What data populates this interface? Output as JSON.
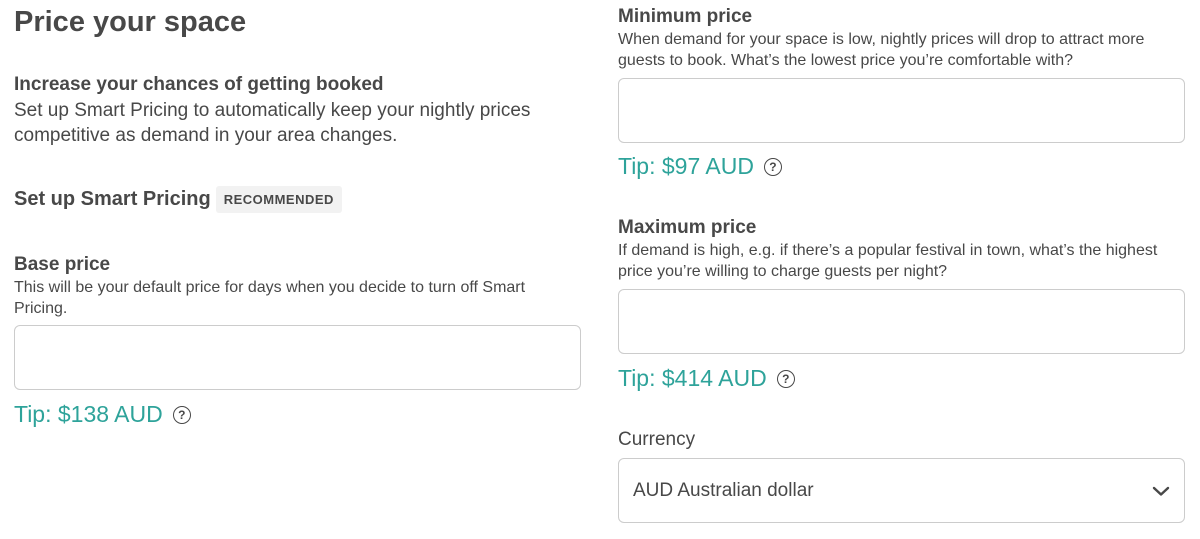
{
  "page": {
    "title": "Price your space"
  },
  "intro": {
    "heading": "Increase your chances of getting booked",
    "description": "Set up Smart Pricing to automatically keep your nightly prices competitive as demand in your area changes."
  },
  "smart_pricing": {
    "heading": "Set up Smart Pricing",
    "badge": "RECOMMENDED"
  },
  "base_price": {
    "label": "Base price",
    "description": "This will be your default price for days when you decide to turn off Smart Pricing.",
    "value": "",
    "placeholder": "",
    "tip": "Tip: $138 AUD"
  },
  "minimum_price": {
    "label": "Minimum price",
    "description": "When demand for your space is low, nightly prices will drop to attract more guests to book. What’s the lowest price you’re comfortable with?",
    "value": "",
    "placeholder": "",
    "tip": "Tip: $97 AUD"
  },
  "maximum_price": {
    "label": "Maximum price",
    "description": "If demand is high, e.g. if there’s a popular festival in town, what’s the highest price you’re willing to charge guests per night?",
    "value": "",
    "placeholder": "",
    "tip": "Tip: $414 AUD"
  },
  "currency": {
    "label": "Currency",
    "selected": "AUD Australian dollar"
  },
  "icons": {
    "help": "help-circle-icon",
    "dropdown": "chevron-down-icon",
    "help_glyph": "?"
  },
  "colors": {
    "text": "#484848",
    "tip": "#2ea39a",
    "border": "#cccccc",
    "badge_bg": "#f2f2f2"
  }
}
